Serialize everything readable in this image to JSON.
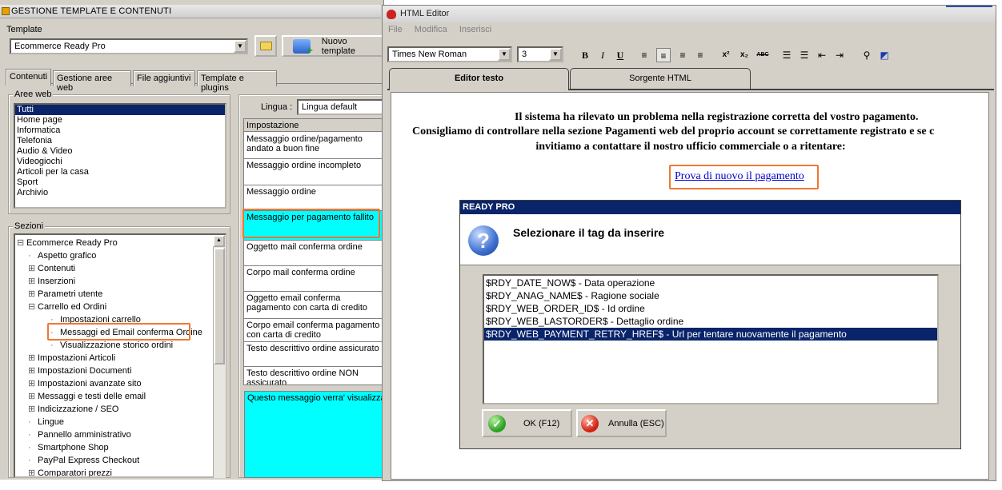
{
  "left": {
    "title": "GESTIONE TEMPLATE E CONTENUTI",
    "template_label": "Template",
    "template_value": "Ecommerce Ready Pro",
    "new_template_label": "Nuovo template",
    "tabs": [
      "Contenuti",
      "Gestione aree web",
      "File aggiuntivi",
      "Template e plugins"
    ],
    "aree_label": "Aree web",
    "aree": [
      "Tutti",
      "Home page",
      "Informatica",
      "Telefonia",
      "Audio & Video",
      "Videogiochi",
      "Articoli per la casa",
      "Sport",
      "Archivio"
    ],
    "sezioni_label": "Sezioni",
    "tree": [
      {
        "text": "Ecommerce Ready Pro",
        "level": 0,
        "sym": "⊟"
      },
      {
        "text": "Aspetto grafico",
        "level": 1,
        "sym": ""
      },
      {
        "text": "Contenuti",
        "level": 1,
        "sym": "⊞"
      },
      {
        "text": "Inserzioni",
        "level": 1,
        "sym": "⊞"
      },
      {
        "text": "Parametri utente",
        "level": 1,
        "sym": "⊞"
      },
      {
        "text": "Carrello ed Ordini",
        "level": 1,
        "sym": "⊟"
      },
      {
        "text": "Impostazioni carrello",
        "level": 2,
        "sym": ""
      },
      {
        "text": "Messaggi ed Email conferma Ordine",
        "level": 2,
        "sym": ""
      },
      {
        "text": "Visualizzazione storico ordini",
        "level": 2,
        "sym": ""
      },
      {
        "text": "Impostazioni Articoli",
        "level": 1,
        "sym": "⊞"
      },
      {
        "text": "Impostazioni Documenti",
        "level": 1,
        "sym": "⊞"
      },
      {
        "text": "Impostazioni avanzate sito",
        "level": 1,
        "sym": "⊞"
      },
      {
        "text": "Messaggi e testi delle email",
        "level": 1,
        "sym": "⊞"
      },
      {
        "text": "Indicizzazione / SEO",
        "level": 1,
        "sym": "⊞"
      },
      {
        "text": "Lingue",
        "level": 1,
        "sym": ""
      },
      {
        "text": "Pannello amministrativo",
        "level": 1,
        "sym": ""
      },
      {
        "text": "Smartphone Shop",
        "level": 1,
        "sym": ""
      },
      {
        "text": "PayPal Express Checkout",
        "level": 1,
        "sym": ""
      },
      {
        "text": "Comparatori prezzi",
        "level": 1,
        "sym": "⊞"
      }
    ],
    "lingua_label": "Lingua :",
    "lingua_value": "Lingua default",
    "imp_header": "Impostazione",
    "imp_rows": [
      "Messaggio ordine/pagamento andato a buon fine",
      "Messaggio ordine incompleto",
      "Messaggio ordine",
      "Messaggio per pagamento fallito",
      "Oggetto mail conferma ordine",
      "Corpo mail conferma ordine",
      "Oggetto email conferma pagamento con carta di credito",
      "Corpo email conferma pagamento con carta di credito",
      "Testo descrittivo ordine assicurato",
      "Testo descrittivo ordine NON assicurato"
    ],
    "preview_text": "Questo messaggio verra' visualizzato"
  },
  "editor": {
    "title": "HTML Editor",
    "menu": [
      "File",
      "Modifica",
      "Inserisci"
    ],
    "font_value": "Times New Roman",
    "size_value": "3",
    "tab_editor": "Editor testo",
    "tab_source": "Sorgente HTML",
    "msg_line1": "Il sistema ha rilevato un problema nella registrazione corretta del vostro pagamento.",
    "msg_line2": "Consigliamo di controllare nella sezione Pagamenti web del proprio account se correttamente registrato e se c",
    "msg_line3": "invitiamo a contattare il nostro ufficio commerciale o a ritentare:",
    "link_text": "Prova di nuovo il pagamento"
  },
  "dialog": {
    "title": "READY PRO",
    "prompt": "Selezionare il tag da inserire",
    "tags": [
      {
        "code": "$RDY_DATE_NOW$",
        "desc": " - Data operazione"
      },
      {
        "code": "$RDY_ANAG_NAME$",
        "desc": " - Ragione sociale"
      },
      {
        "code": "$RDY_WEB_ORDER_ID$",
        "desc": " - Id ordine"
      },
      {
        "code": "$RDY_WEB_LASTORDER$",
        "desc": " - Dettaglio ordine"
      },
      {
        "code": "$RDY_WEB_PAYMENT_RETRY_HREF$",
        "desc": " - Url per tentare nuovamente il pagamento"
      }
    ],
    "selected_index": 4,
    "ok_label": "OK (F12)",
    "cancel_label": "Annulla (ESC)"
  },
  "colors": {
    "selection": "#0a246a",
    "highlight_cell": "#00ffff",
    "annotation": "#f07830",
    "link": "#0000cc"
  }
}
